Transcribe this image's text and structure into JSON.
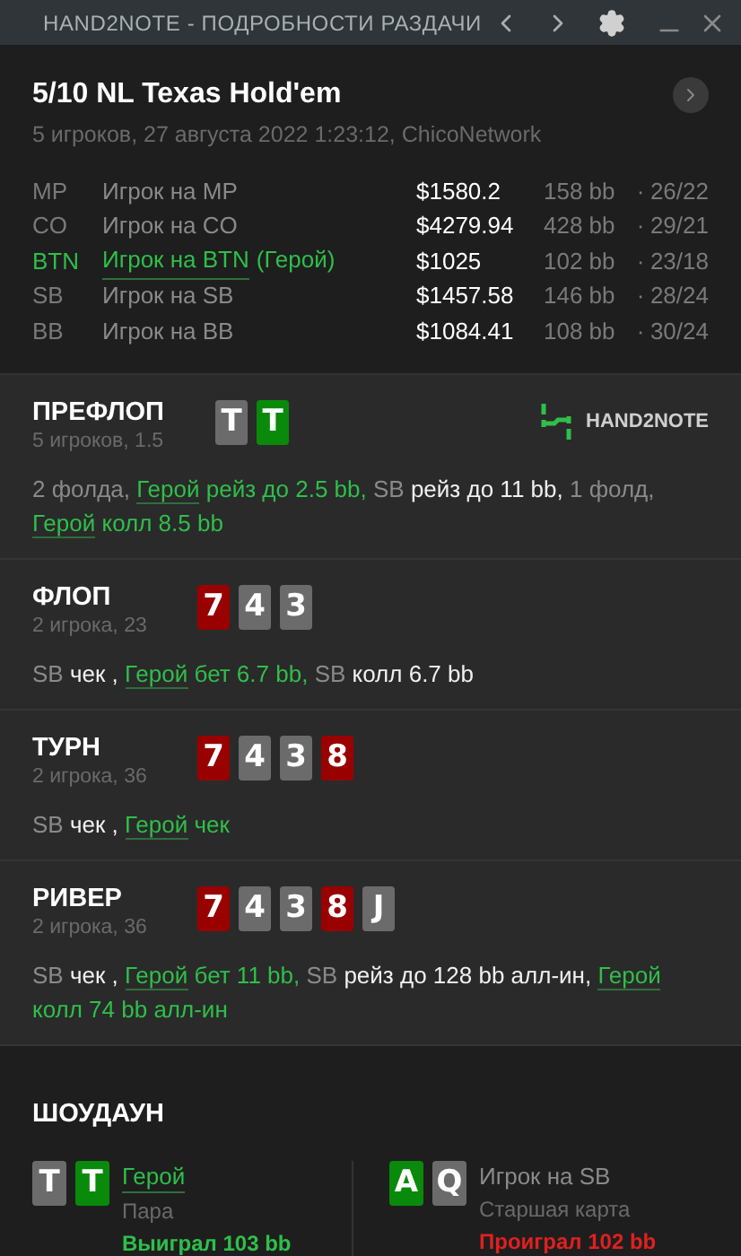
{
  "window": {
    "title": "HAND2NOTE - ПОДРОБНОСТИ РАЗДАЧИ"
  },
  "hand": {
    "title": "5/10 NL Texas Hold'em",
    "subtitle": "5 игроков, 27 августа 2022 1:23:12, ChicoNetwork"
  },
  "players": [
    {
      "position": "MP",
      "name": "Игрок на MP",
      "hero": false,
      "stack": "$1580.2",
      "bb": "158 bb",
      "sep": "·",
      "stats": "26/22"
    },
    {
      "position": "CO",
      "name": "Игрок на CO",
      "hero": false,
      "stack": "$4279.94",
      "bb": "428 bb",
      "sep": "·",
      "stats": "29/21"
    },
    {
      "position": "BTN",
      "name": "Игрок на BTN",
      "hero_tag": "(Герой)",
      "hero": true,
      "stack": "$1025",
      "bb": "102 bb",
      "sep": "·",
      "stats": "23/18"
    },
    {
      "position": "SB",
      "name": "Игрок на SB",
      "hero": false,
      "stack": "$1457.58",
      "bb": "146 bb",
      "sep": "·",
      "stats": "28/24"
    },
    {
      "position": "BB",
      "name": "Игрок на BB",
      "hero": false,
      "stack": "$1084.41",
      "bb": "108 bb",
      "sep": "·",
      "stats": "30/24"
    }
  ],
  "streets": [
    {
      "name": "ПРЕФЛОП",
      "info": "5 игроков, 1.5",
      "logo": "HAND2NOTE",
      "cards": [
        {
          "rank": "T",
          "color": "#6b6b6b"
        },
        {
          "rank": "T",
          "color": "#0a8a0a"
        }
      ],
      "actions": [
        {
          "kind": "muted",
          "text": "2 фолда,"
        },
        {
          "kind": "hero_link",
          "text": "Герой"
        },
        {
          "kind": "hero",
          "text": "рейз до 2.5 bb,"
        },
        {
          "kind": "muted",
          "text": "SB"
        },
        {
          "kind": "plain",
          "text": "рейз до 11 bb,"
        },
        {
          "kind": "muted",
          "text": "1 фолд,"
        },
        {
          "kind": "hero_link",
          "text": "Герой"
        },
        {
          "kind": "hero",
          "text": "колл 8.5 bb"
        }
      ]
    },
    {
      "name": "ФЛОП",
      "info": "2 игрока, 23",
      "cards": [
        {
          "rank": "7",
          "color": "#990000"
        },
        {
          "rank": "4",
          "color": "#6b6b6b"
        },
        {
          "rank": "3",
          "color": "#6b6b6b"
        }
      ],
      "actions": [
        {
          "kind": "muted",
          "text": "SB"
        },
        {
          "kind": "plain",
          "text": "чек ,"
        },
        {
          "kind": "hero_link",
          "text": "Герой"
        },
        {
          "kind": "hero",
          "text": "бет 6.7 bb,"
        },
        {
          "kind": "muted",
          "text": "SB"
        },
        {
          "kind": "plain",
          "text": "колл 6.7 bb"
        }
      ]
    },
    {
      "name": "ТУРН",
      "info": "2 игрока, 36",
      "cards": [
        {
          "rank": "7",
          "color": "#990000"
        },
        {
          "rank": "4",
          "color": "#6b6b6b"
        },
        {
          "rank": "3",
          "color": "#6b6b6b"
        },
        {
          "rank": "8",
          "color": "#990000"
        }
      ],
      "actions": [
        {
          "kind": "muted",
          "text": "SB"
        },
        {
          "kind": "plain",
          "text": "чек ,"
        },
        {
          "kind": "hero_link",
          "text": "Герой"
        },
        {
          "kind": "hero",
          "text": "чек"
        }
      ]
    },
    {
      "name": "РИВЕР",
      "info": "2 игрока, 36",
      "cards": [
        {
          "rank": "7",
          "color": "#990000"
        },
        {
          "rank": "4",
          "color": "#6b6b6b"
        },
        {
          "rank": "3",
          "color": "#6b6b6b"
        },
        {
          "rank": "8",
          "color": "#990000"
        },
        {
          "rank": "J",
          "color": "#6b6b6b"
        }
      ],
      "actions": [
        {
          "kind": "muted",
          "text": "SB"
        },
        {
          "kind": "plain",
          "text": "чек ,"
        },
        {
          "kind": "hero_link",
          "text": "Герой"
        },
        {
          "kind": "hero",
          "text": "бет 11 bb,"
        },
        {
          "kind": "muted",
          "text": "SB"
        },
        {
          "kind": "plain",
          "text": "рейз до 128 bb алл-ин,"
        },
        {
          "kind": "hero_link",
          "text": "Герой"
        },
        {
          "kind": "hero",
          "text": "колл 74 bb алл-ин"
        }
      ]
    }
  ],
  "showdown": {
    "title": "ШОУДАУН",
    "hands": [
      {
        "player": "Герой",
        "hero": true,
        "combo": "Пара",
        "result": "Выиграл 103 bb",
        "won": true,
        "cards": [
          {
            "rank": "T",
            "color": "#6b6b6b"
          },
          {
            "rank": "T",
            "color": "#0a8a0a"
          }
        ]
      },
      {
        "player": "Игрок на SB",
        "hero": false,
        "combo": "Старшая карта",
        "result": "Проиграл 102 bb",
        "won": false,
        "cards": [
          {
            "rank": "A",
            "color": "#0a8a0a"
          },
          {
            "rank": "Q",
            "color": "#6b6b6b"
          }
        ]
      }
    ]
  }
}
